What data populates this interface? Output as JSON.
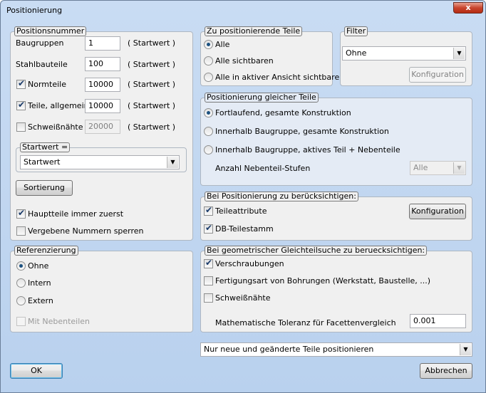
{
  "window": {
    "title": "Positionierung",
    "close_label": "x"
  },
  "positionsnummer": {
    "legend": "Positionsnummer",
    "rows": [
      {
        "label": "Baugruppen",
        "value": "1",
        "suffix": "( Startwert )"
      },
      {
        "label": "Stahlbauteile",
        "value": "100",
        "suffix": "( Startwert )"
      },
      {
        "label": "Normteile",
        "value": "10000",
        "suffix": "( Startwert )",
        "checked": true
      },
      {
        "label": "Teile, allgemein",
        "value": "10000",
        "suffix": "( Startwert )",
        "checked": true
      },
      {
        "label": "Schweißnähte",
        "value": "20000",
        "suffix": "( Startwert )",
        "checked": false,
        "disabled": true
      }
    ],
    "startwert_legend": "Startwert =",
    "startwert_value": "Startwert",
    "sortierung_label": "Sortierung",
    "hauptteile_label": "Hauptteile immer zuerst",
    "hauptteile_checked": true,
    "vergebene_label": "Vergebene Nummern sperren",
    "vergebene_checked": false
  },
  "referenzierung": {
    "legend": "Referenzierung",
    "options": [
      "Ohne",
      "Intern",
      "Extern"
    ],
    "selected": "Ohne",
    "nebenteile_label": "Mit Nebenteilen"
  },
  "zu_positionierende": {
    "legend": "Zu positionierende Teile",
    "options": [
      "Alle",
      "Alle sichtbaren",
      "Alle in aktiver Ansicht sichtbaren"
    ],
    "selected": "Alle"
  },
  "filter": {
    "legend": "Filter",
    "value": "Ohne",
    "konfiguration_label": "Konfiguration"
  },
  "gleiche_teile": {
    "legend": "Positionierung gleicher Teile",
    "options": [
      "Fortlaufend, gesamte Konstruktion",
      "Innerhalb Baugruppe, gesamte Konstruktion",
      "Innerhalb Baugruppe, aktives Teil + Nebenteile"
    ],
    "selected": "Fortlaufend, gesamte Konstruktion",
    "stufen_label": "Anzahl Nebenteil-Stufen",
    "stufen_value": "Alle"
  },
  "beruecksichtigen": {
    "legend": "Bei Positionierung zu berücksichtigen:",
    "items": [
      {
        "label": "Teileattribute",
        "checked": true
      },
      {
        "label": "DB-Teilestamm",
        "checked": true
      }
    ],
    "konfiguration_label": "Konfiguration"
  },
  "geometrisch": {
    "legend": "Bei geometrischer Gleichteilsuche zu beruecksichtigen:",
    "items": [
      {
        "label": "Verschraubungen",
        "checked": true
      },
      {
        "label": "Fertigungsart von Bohrungen (Werkstatt, Baustelle, ...)",
        "checked": false
      },
      {
        "label": "Schweißnähte",
        "checked": false
      }
    ],
    "toleranz_label": "Mathematische Toleranz für Facettenvergleich",
    "toleranz_value": "0.001"
  },
  "mode_dropdown": {
    "value": "Nur neue und geänderte Teile positionieren"
  },
  "buttons": {
    "ok": "OK",
    "abbrechen": "Abbrechen"
  }
}
